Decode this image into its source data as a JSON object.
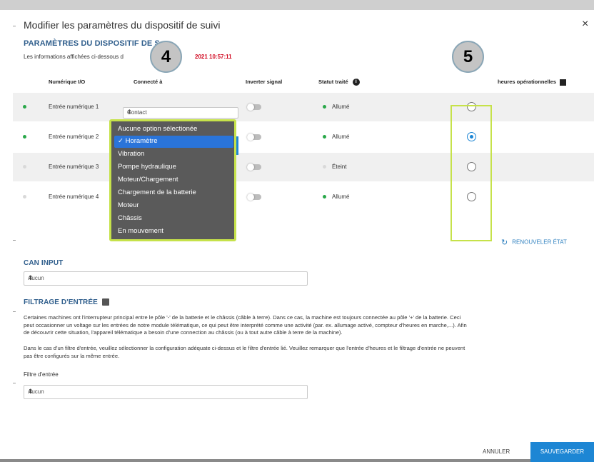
{
  "dialog": {
    "title": "Modifier les paramètres du dispositif de suivi",
    "close_icon": "×"
  },
  "params": {
    "heading": "PARAMÈTRES DU DISPOSITIF DE S",
    "info_prefix": "Les informations affichées ci-dessous d",
    "info_time": "2021 10:57:11"
  },
  "columns": {
    "numeric": "Numérique I/O",
    "connected": "Connecté à",
    "inverter": "Inverter signal",
    "status": "Statut traité",
    "hours": "heures opérationnelles"
  },
  "rows": [
    {
      "label": "Entrée numérique 1",
      "status": "Allumé",
      "status_on": true,
      "selected": false
    },
    {
      "label": "Entrée numérique 2",
      "status": "Allumé",
      "status_on": true,
      "selected": true
    },
    {
      "label": "Entrée numérique 3",
      "status": "Éteint",
      "status_on": false,
      "selected": false
    },
    {
      "label": "Entrée numérique 4",
      "status": "Allumé",
      "status_on": true,
      "selected": false
    }
  ],
  "row1_select": "Contact",
  "dropdown": {
    "options": [
      "Aucune option sélectionée",
      "✓ Horamètre",
      "Vibration",
      "Pompe hydraulique",
      "Moteur/Chargement",
      "Chargement de la batterie",
      "Moteur",
      "Châssis",
      "En mouvement"
    ],
    "selected_index": 1
  },
  "callouts": {
    "left": "4",
    "right": "5"
  },
  "renew_label": "RENOUVELER ÉTAT",
  "can_input": {
    "heading": "CAN INPUT",
    "value": "Aucun"
  },
  "filter": {
    "heading": "FILTRAGE D'ENTRÉE",
    "para1_l1": "Certaines machines ont l'interrupteur principal entre le pôle '-' de la batterie et le châssis (câble à terre). Dans ce cas, la machine est toujours connectée au pôle '+' de la batterie. Ceci",
    "para1_l2": "peut occasionner un voltage sur les entrées de notre module télématique, ce qui peut être interprété comme une activité (par. ex. allumage activé, compteur d'heures en marche,...). Afin",
    "para1_l3": "de découvrir cette situation, l'appareil télématique a besoin d'une connection au châssis (ou à tout autre câble à terre de la machine).",
    "para2_l1": "Dans le cas d'un filtre d'entrée, veuillez sélectionner la configuration adéquate ci-dessus et le filtre d'entrée lié. Veuillez remarquer que l'entrée d'heures et le filtrage d'entrée ne peuvent",
    "para2_l2": "pas être configurés sur la même entrée.",
    "field_label": "Filtre d'entrée",
    "field_value": "Aucun"
  },
  "buttons": {
    "cancel": "ANNULER",
    "save": "SAUVEGARDER"
  },
  "colors": {
    "accent": "#1d86d4",
    "highlight": "#c6e24a",
    "heading": "#2f5e8c",
    "on": "#2aa84a"
  }
}
